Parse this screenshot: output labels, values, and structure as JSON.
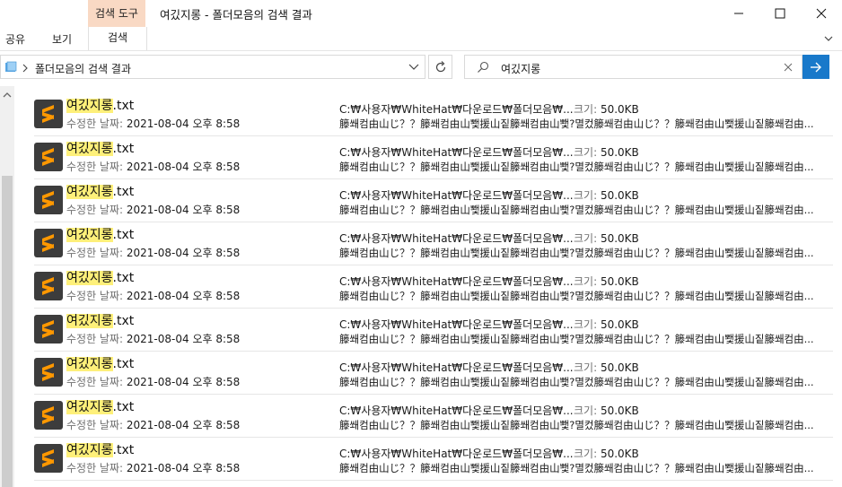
{
  "window": {
    "title": "여깄지롱 - 폴더모음의 검색 결과",
    "context_tab_group": "검색 도구"
  },
  "ribbon": {
    "tabs": [
      "공유",
      "보기",
      "검색"
    ]
  },
  "address": {
    "path": "폴더모음의 검색 결과"
  },
  "search": {
    "query": "여깄지롱"
  },
  "colors": {
    "accent": "#1979ca",
    "highlight": "#fef07a",
    "context_tab": "#f9d9c4"
  },
  "results": [
    {
      "name_match": "여깄지롱",
      "name_ext": ".txt",
      "modified_label": "수정한 날짜:",
      "modified": "2021-08-04 오후 8:58",
      "path": "C:₩사용자₩WhiteHat₩다운로드₩폴더모음₩...",
      "size_label": "크기:",
      "size": "50.0KB",
      "preview": "籐쐐컴由山じ？？籐쐐컴由山뾏援山짙籐쐐컴由山뾏?멸컸籐쐐컴由山じ？？籐쐐컴由山뾏援山짙籐쐐컴由..."
    },
    {
      "name_match": "여깄지롱",
      "name_ext": ".txt",
      "modified_label": "수정한 날짜:",
      "modified": "2021-08-04 오후 8:58",
      "path": "C:₩사용자₩WhiteHat₩다운로드₩폴더모음₩...",
      "size_label": "크기:",
      "size": "50.0KB",
      "preview": "籐쐐컴由山じ？？籐쐐컴由山뾏援山짙籐쐐컴由山뾏?멸컸籐쐐컴由山じ？？籐쐐컴由山뾏援山짙籐쐐컴由..."
    },
    {
      "name_match": "여깄지롱",
      "name_ext": ".txt",
      "modified_label": "수정한 날짜:",
      "modified": "2021-08-04 오후 8:58",
      "path": "C:₩사용자₩WhiteHat₩다운로드₩폴더모음₩...",
      "size_label": "크기:",
      "size": "50.0KB",
      "preview": "籐쐐컴由山じ？？籐쐐컴由山뾏援山짙籐쐐컴由山뾏?멸컸籐쐐컴由山じ？？籐쐐컴由山뾏援山짙籐쐐컴由..."
    },
    {
      "name_match": "여깄지롱",
      "name_ext": ".txt",
      "modified_label": "수정한 날짜:",
      "modified": "2021-08-04 오후 8:58",
      "path": "C:₩사용자₩WhiteHat₩다운로드₩폴더모음₩...",
      "size_label": "크기:",
      "size": "50.0KB",
      "preview": "籐쐐컴由山じ？？籐쐐컴由山뾏援山짙籐쐐컴由山뾏?멸컸籐쐐컴由山じ？？籐쐐컴由山뾏援山짙籐쐐컴由..."
    },
    {
      "name_match": "여깄지롱",
      "name_ext": ".txt",
      "modified_label": "수정한 날짜:",
      "modified": "2021-08-04 오후 8:58",
      "path": "C:₩사용자₩WhiteHat₩다운로드₩폴더모음₩...",
      "size_label": "크기:",
      "size": "50.0KB",
      "preview": "籐쐐컴由山じ？？籐쐐컴由山뾏援山짙籐쐐컴由山뾏?멸컸籐쐐컴由山じ？？籐쐐컴由山뾏援山짙籐쐐컴由..."
    },
    {
      "name_match": "여깄지롱",
      "name_ext": ".txt",
      "modified_label": "수정한 날짜:",
      "modified": "2021-08-04 오후 8:58",
      "path": "C:₩사용자₩WhiteHat₩다운로드₩폴더모음₩...",
      "size_label": "크기:",
      "size": "50.0KB",
      "preview": "籐쐐컴由山じ？？籐쐐컴由山뾏援山짙籐쐐컴由山뾏?멸컸籐쐐컴由山じ？？籐쐐컴由山뾏援山짙籐쐐컴由..."
    },
    {
      "name_match": "여깄지롱",
      "name_ext": ".txt",
      "modified_label": "수정한 날짜:",
      "modified": "2021-08-04 오후 8:58",
      "path": "C:₩사용자₩WhiteHat₩다운로드₩폴더모음₩...",
      "size_label": "크기:",
      "size": "50.0KB",
      "preview": "籐쐐컴由山じ？？籐쐐컴由山뾏援山짙籐쐐컴由山뾏?멸컸籐쐐컴由山じ？？籐쐐컴由山뾏援山짙籐쐐컴由..."
    },
    {
      "name_match": "여깄지롱",
      "name_ext": ".txt",
      "modified_label": "수정한 날짜:",
      "modified": "2021-08-04 오후 8:58",
      "path": "C:₩사용자₩WhiteHat₩다운로드₩폴더모음₩...",
      "size_label": "크기:",
      "size": "50.0KB",
      "preview": "籐쐐컴由山じ？？籐쐐컴由山뾏援山짙籐쐐컴由山뾏?멸컸籐쐐컴由山じ？？籐쐐컴由山뾏援山짙籐쐐컴由..."
    },
    {
      "name_match": "여깄지롱",
      "name_ext": ".txt",
      "modified_label": "수정한 날짜:",
      "modified": "2021-08-04 오후 8:58",
      "path": "C:₩사용자₩WhiteHat₩다운로드₩폴더모음₩...",
      "size_label": "크기:",
      "size": "50.0KB",
      "preview": "籐쐐컴由山じ？？籐쐐컴由山뾏援山짙籐쐐컴由山뾏?멸컸籐쐐컴由山じ？？籐쐐컴由山뾏援山짙籐쐐컴由..."
    }
  ]
}
